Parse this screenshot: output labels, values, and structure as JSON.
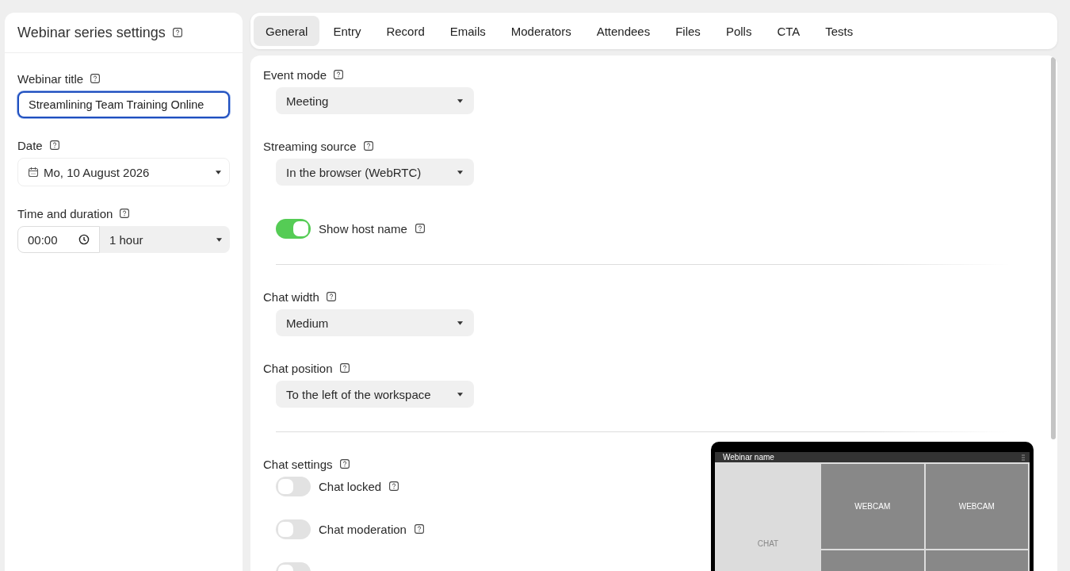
{
  "sidebar": {
    "title": "Webinar series settings",
    "fields": [
      {
        "kind": "text",
        "label": "Webinar title",
        "value": "Streamlining Team Training Online",
        "focused": true
      },
      {
        "kind": "date",
        "label": "Date",
        "value": "Mo, 10 August 2026"
      },
      {
        "kind": "time",
        "label": "Time and duration",
        "value": "00:00",
        "duration": "1 hour"
      }
    ]
  },
  "tabs": [
    {
      "label": "General",
      "selected": true
    },
    {
      "label": "Entry",
      "selected": false
    },
    {
      "label": "Record",
      "selected": false
    },
    {
      "label": "Emails",
      "selected": false
    },
    {
      "label": "Moderators",
      "selected": false
    },
    {
      "label": "Attendees",
      "selected": false
    },
    {
      "label": "Files",
      "selected": false
    },
    {
      "label": "Polls",
      "selected": false
    },
    {
      "label": "CTA",
      "selected": false
    },
    {
      "label": "Tests",
      "selected": false
    }
  ],
  "sections": [
    {
      "kind": "select",
      "label": "Event mode",
      "value": "Meeting"
    },
    {
      "kind": "select",
      "label": "Streaming source",
      "value": "In the browser (WebRTC)"
    },
    {
      "kind": "toggle",
      "label": "Show host name",
      "on": true
    },
    {
      "kind": "divider"
    },
    {
      "kind": "select",
      "label": "Chat width",
      "value": "Medium"
    },
    {
      "kind": "select",
      "label": "Chat position",
      "value": "To the left of the workspace"
    },
    {
      "kind": "divider"
    },
    {
      "kind": "group",
      "label": "Chat settings",
      "toggles": [
        {
          "label": "Chat locked",
          "on": false
        },
        {
          "label": "Chat moderation",
          "on": false
        },
        {
          "on": false
        }
      ]
    }
  ],
  "preview": {
    "title": "Webinar name",
    "chat": "CHAT",
    "cells": [
      "WEBCAM",
      "WEBCAM"
    ]
  }
}
